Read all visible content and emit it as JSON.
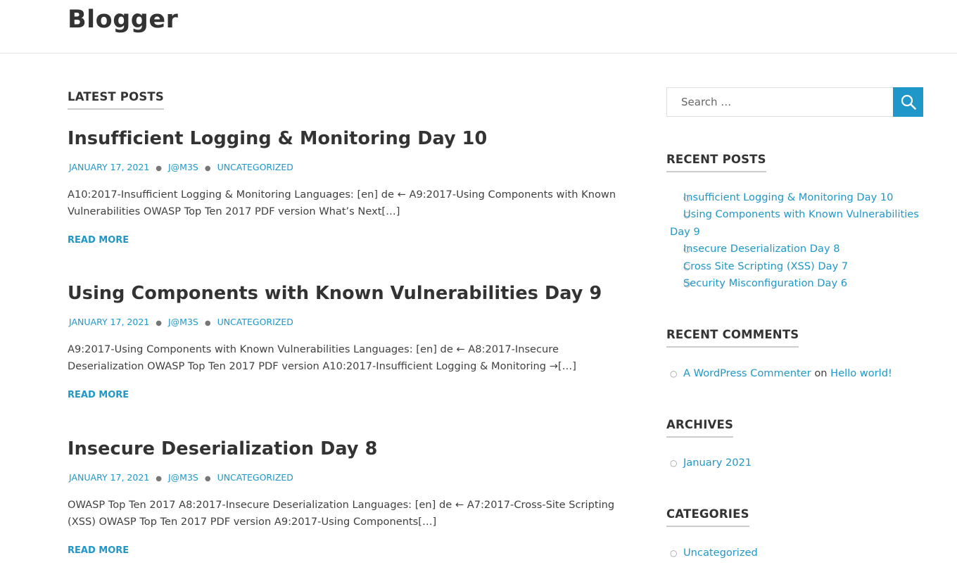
{
  "site": {
    "title": "Blogger"
  },
  "main": {
    "archive_title": "Latest Posts",
    "posts": [
      {
        "title": "Insufficient Logging & Monitoring Day 10",
        "date": "January 17, 2021",
        "author": "J@M3S",
        "category": "Uncategorized",
        "excerpt": "A10:2017-Insufficient Logging & Monitoring Languages: [en] de ← A9:2017-Using Components with Known Vulnerabilities OWASP Top Ten 2017 PDF version What’s Next[…]",
        "read_more": "Read More"
      },
      {
        "title": "Using Components with Known Vulnerabilities Day 9",
        "date": "January 17, 2021",
        "author": "J@M3S",
        "category": "Uncategorized",
        "excerpt": "A9:2017-Using Components with Known Vulnerabilities Languages: [en] de ← A8:2017-Insecure Deserialization OWASP Top Ten 2017 PDF version A10:2017-Insufficient Logging & Monitoring →[…]",
        "read_more": "Read More"
      },
      {
        "title": "Insecure Deserialization Day 8",
        "date": "January 17, 2021",
        "author": "J@M3S",
        "category": "Uncategorized",
        "excerpt": "OWASP Top Ten 2017 A8:2017-Insecure Deserialization Languages: [en] de ← A7:2017-Cross-Site Scripting (XSS) OWASP Top Ten 2017 PDF version A9:2017-Using Components[…]",
        "read_more": "Read More"
      }
    ]
  },
  "sidebar": {
    "search": {
      "placeholder": "Search …",
      "icon": "search-icon"
    },
    "recent_posts": {
      "title": "Recent Posts",
      "items": [
        "Insufficient Logging & Monitoring Day 10",
        "Using Components with Known Vulnerabilities Day 9",
        "Insecure Deserialization Day 8",
        "Cross Site Scripting (XSS) Day 7",
        "Security Misconfiguration Day 6"
      ]
    },
    "recent_comments": {
      "title": "Recent Comments",
      "items": [
        {
          "author": "A WordPress Commenter",
          "on": "on",
          "post": "Hello world!"
        }
      ]
    },
    "archives": {
      "title": "Archives",
      "items": [
        "January 2021"
      ]
    },
    "categories": {
      "title": "Categories",
      "items": [
        "Uncategorized"
      ]
    }
  },
  "colors": {
    "accent": "#2097c9",
    "text": "#333333",
    "border": "#e2e2e2"
  }
}
